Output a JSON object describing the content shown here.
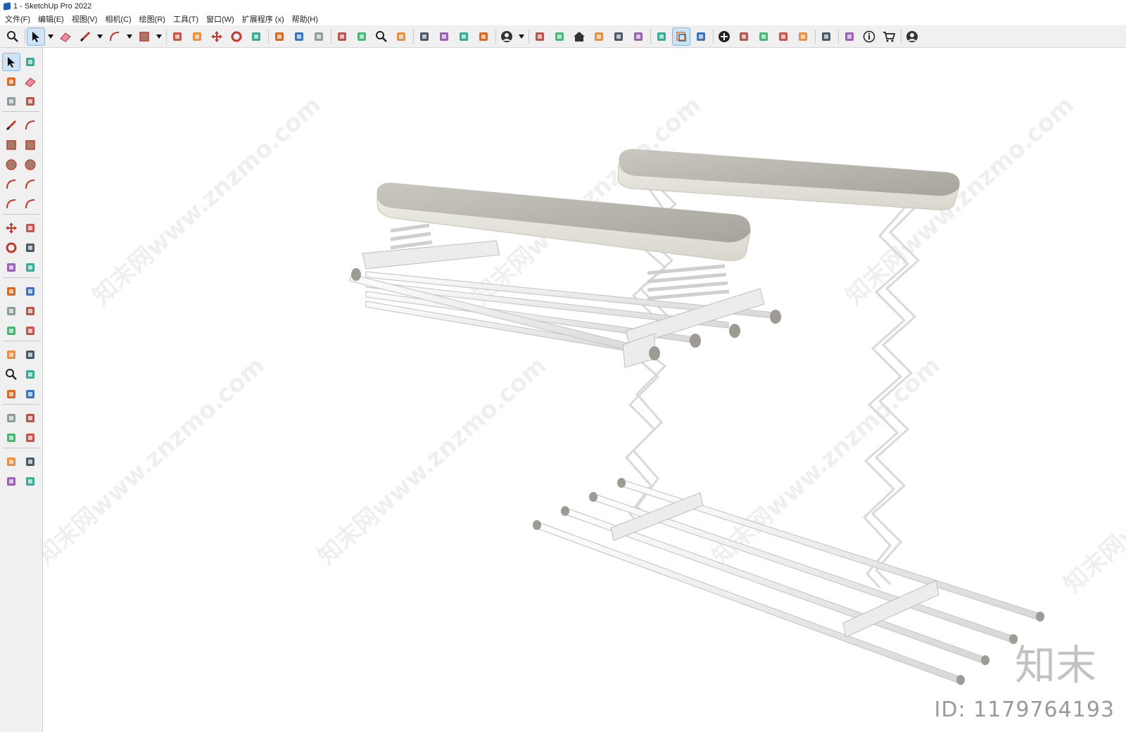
{
  "window": {
    "title": "1 - SketchUp Pro 2022"
  },
  "menu": [
    "文件(F)",
    "编辑(E)",
    "视图(V)",
    "相机(C)",
    "绘图(R)",
    "工具(T)",
    "窗口(W)",
    "扩展程序 (x)",
    "帮助(H)"
  ],
  "top_toolbar": [
    {
      "name": "search-icon"
    },
    {
      "name": "select-icon",
      "active": true
    },
    {
      "name": "dropdown-icon"
    },
    {
      "name": "eraser-icon"
    },
    {
      "name": "pencil-icon"
    },
    {
      "name": "dropdown-icon"
    },
    {
      "name": "arc-icon"
    },
    {
      "name": "dropdown-icon"
    },
    {
      "name": "rectangle-icon"
    },
    {
      "name": "dropdown-icon"
    },
    {
      "name": "push-pull-icon"
    },
    {
      "name": "follow-me-icon"
    },
    {
      "name": "move-icon"
    },
    {
      "name": "rotate-icon"
    },
    {
      "name": "scale-icon"
    },
    {
      "name": "tape-measure-icon"
    },
    {
      "name": "text-icon"
    },
    {
      "name": "paint-bucket-icon"
    },
    {
      "name": "orbit-icon"
    },
    {
      "name": "pan-icon"
    },
    {
      "name": "zoom-icon"
    },
    {
      "name": "zoom-extents-icon"
    },
    {
      "name": "warehouse-icon"
    },
    {
      "name": "extension-warehouse-icon"
    },
    {
      "name": "layout-icon"
    },
    {
      "name": "extension-manager-icon"
    },
    {
      "name": "user-icon"
    },
    {
      "name": "dropdown-icon"
    },
    {
      "name": "iso-view-icon"
    },
    {
      "name": "front-view-icon"
    },
    {
      "name": "home-icon"
    },
    {
      "name": "top-view-icon"
    },
    {
      "name": "right-view-icon"
    },
    {
      "name": "back-view-icon"
    },
    {
      "name": "section-icon"
    },
    {
      "name": "section-display-icon",
      "active": true
    },
    {
      "name": "section-cut-icon"
    },
    {
      "name": "add-icon"
    },
    {
      "name": "solid-inspector-icon"
    },
    {
      "name": "styles-icon"
    },
    {
      "name": "checker-icon"
    },
    {
      "name": "cloud-icon"
    },
    {
      "name": "settings-icon"
    },
    {
      "name": "scenes-icon"
    },
    {
      "name": "info-icon"
    },
    {
      "name": "cart-icon"
    },
    {
      "name": "account-icon"
    }
  ],
  "left_toolbar": [
    "select-icon",
    "lasso-orbit-icon",
    "paint-bucket-icon",
    "eraser-icon",
    "component-icon",
    "tag-icon",
    "line-icon",
    "freehand-icon",
    "rectangle-icon",
    "rotated-rectangle-icon",
    "circle-icon",
    "polygon-icon",
    "arc-icon",
    "two-point-arc-icon",
    "three-point-arc-icon",
    "pie-icon",
    "move-icon",
    "push-pull-icon",
    "rotate-icon",
    "follow-me-icon",
    "scale-icon",
    "offset-icon",
    "tape-measure-icon",
    "dimension-icon",
    "protractor-icon",
    "text-icon",
    "axes-icon",
    "3d-text-icon",
    "orbit-icon",
    "pan-icon",
    "zoom-icon",
    "zoom-window-icon",
    "zoom-extents-icon",
    "previous-view-icon",
    "position-camera-icon",
    "look-around-icon",
    "walk-icon",
    "section-plane-icon",
    "warehouse-icon",
    "extension-warehouse-icon",
    "layout-icon",
    "extension-manager-icon"
  ],
  "watermark": {
    "brand": "知末",
    "id": "ID: 1179764193",
    "site": "知末网www.znzmo.com"
  }
}
